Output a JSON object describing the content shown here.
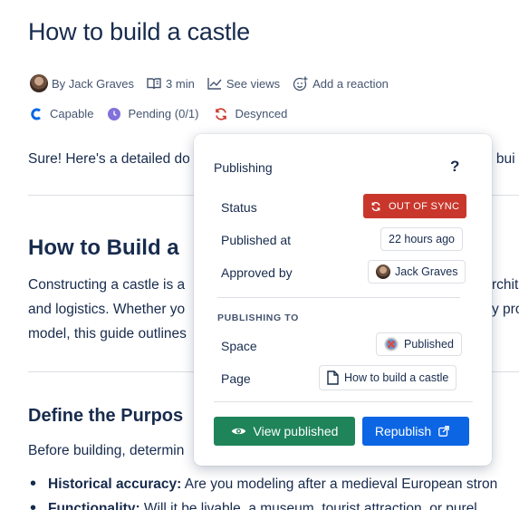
{
  "page": {
    "title": "How to build a castle"
  },
  "byline": {
    "author": "By Jack Graves",
    "read_time": "3 min",
    "views": "See views",
    "reaction": "Add a reaction"
  },
  "badges": {
    "capable": "Capable",
    "pending": "Pending (0/1)",
    "desynced": "Desynced"
  },
  "content": {
    "intro": "Sure! Here's a detailed do",
    "intro_tail": "o bui",
    "h2": "How to Build a",
    "para_lines": [
      "Constructing a castle is a",
      "and logistics. Whether yo",
      "model, this guide outlines"
    ],
    "para_tails": [
      "rchite",
      "y pro"
    ],
    "h3": "Define the Purpos",
    "para2": "Before building, determin",
    "bullet1_bold": "Historical accuracy:",
    "bullet1_rest": " Are you modeling after a medieval European stron",
    "bullet2_bold": "Functionality:",
    "bullet2_rest": " Will it be livable, a museum, tourist attraction, or purel"
  },
  "popup": {
    "title": "Publishing",
    "help": "?",
    "status_label": "Status",
    "status_value": "OUT OF SYNC",
    "published_at_label": "Published at",
    "published_at_value": "22 hours ago",
    "approved_by_label": "Approved by",
    "approved_by_value": "Jack Graves",
    "publishing_to": "PUBLISHING TO",
    "space_label": "Space",
    "space_value": "Published",
    "page_label": "Page",
    "page_value": "How to build a castle",
    "view_published": "View published",
    "republish": "Republish"
  },
  "colors": {
    "out_of_sync": "#c9372c",
    "view_published": "#1f845a",
    "republish": "#0c66e4",
    "capable": "#0c66e4",
    "pending": "#8270db",
    "desynced": "#c9372c"
  }
}
